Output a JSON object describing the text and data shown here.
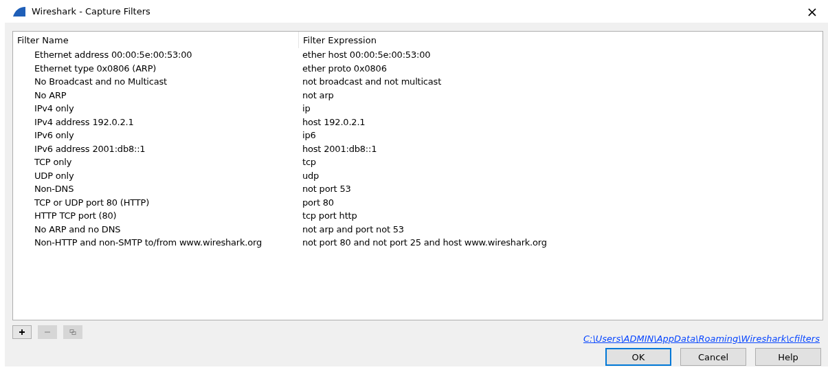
{
  "window": {
    "title": "Wireshark - Capture Filters",
    "close": "×"
  },
  "table": {
    "columns": [
      "Filter Name",
      "Filter Expression"
    ],
    "rows": [
      [
        "Ethernet address 00:00:5e:00:53:00",
        "ether host 00:00:5e:00:53:00"
      ],
      [
        "Ethernet type 0x0806 (ARP)",
        "ether proto 0x0806"
      ],
      [
        "No Broadcast and no Multicast",
        "not broadcast and not multicast"
      ],
      [
        "No ARP",
        "not arp"
      ],
      [
        "IPv4 only",
        "ip"
      ],
      [
        "IPv4 address 192.0.2.1",
        "host 192.0.2.1"
      ],
      [
        "IPv6 only",
        "ip6"
      ],
      [
        "IPv6 address 2001:db8::1",
        "host 2001:db8::1"
      ],
      [
        "TCP only",
        "tcp"
      ],
      [
        "UDP only",
        "udp"
      ],
      [
        "Non-DNS",
        "not port 53"
      ],
      [
        "TCP or UDP port 80 (HTTP)",
        "port 80"
      ],
      [
        "HTTP TCP port (80)",
        "tcp port http"
      ],
      [
        "No ARP and no DNS",
        "not arp and port not 53"
      ],
      [
        "Non-HTTP and non-SMTP to/from www.wireshark.org",
        "not port 80 and not port 25 and host www.wireshark.org"
      ]
    ]
  },
  "tools": [
    {
      "kind": "add",
      "disabled": false
    },
    {
      "kind": "remove",
      "disabled": true
    },
    {
      "kind": "copy",
      "disabled": true
    }
  ],
  "file_link": "C:\\Users\\ADMIN\\AppData\\Roaming\\Wireshark\\cfilters",
  "buttons": [
    {
      "label": "OK",
      "focused": true
    },
    {
      "label": "Cancel",
      "focused": false
    },
    {
      "label": "Help",
      "focused": false
    }
  ]
}
